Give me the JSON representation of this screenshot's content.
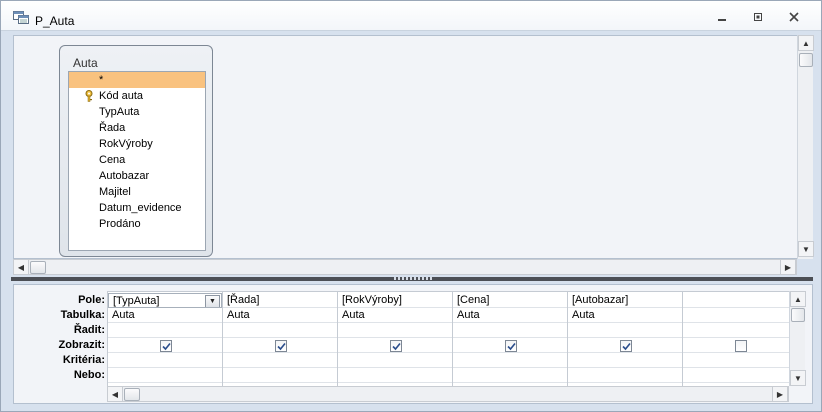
{
  "window": {
    "title": "P_Auta"
  },
  "field_list": {
    "title": "Auta",
    "items": [
      {
        "label": "*",
        "selected": true,
        "key": false
      },
      {
        "label": "Kód auta",
        "selected": false,
        "key": true
      },
      {
        "label": "TypAuta",
        "selected": false,
        "key": false
      },
      {
        "label": "Řada",
        "selected": false,
        "key": false
      },
      {
        "label": "RokVýroby",
        "selected": false,
        "key": false
      },
      {
        "label": "Cena",
        "selected": false,
        "key": false
      },
      {
        "label": "Autobazar",
        "selected": false,
        "key": false
      },
      {
        "label": "Majitel",
        "selected": false,
        "key": false
      },
      {
        "label": "Datum_evidence",
        "selected": false,
        "key": false
      },
      {
        "label": "Prodáno",
        "selected": false,
        "key": false
      }
    ]
  },
  "grid": {
    "row_labels": [
      "Pole:",
      "Tabulka:",
      "Řadit:",
      "Zobrazit:",
      "Kritéria:",
      "Nebo:"
    ],
    "columns": [
      {
        "field": "[TypAuta]",
        "table": "Auta",
        "sort": "",
        "show": true,
        "criteria": "",
        "or": ""
      },
      {
        "field": "[Řada]",
        "table": "Auta",
        "sort": "",
        "show": true,
        "criteria": "",
        "or": ""
      },
      {
        "field": "[RokVýroby]",
        "table": "Auta",
        "sort": "",
        "show": true,
        "criteria": "",
        "or": ""
      },
      {
        "field": "[Cena]",
        "table": "Auta",
        "sort": "",
        "show": true,
        "criteria": "",
        "or": ""
      },
      {
        "field": "[Autobazar]",
        "table": "Auta",
        "sort": "",
        "show": true,
        "criteria": "",
        "or": ""
      },
      {
        "field": "",
        "table": "",
        "sort": "",
        "show": false,
        "criteria": "",
        "or": ""
      }
    ]
  },
  "icons": {
    "title": "query-design-icon",
    "key": "primary-key-icon",
    "minimize": "minimize-icon",
    "maximize": "restore-icon",
    "close": "close-icon"
  }
}
